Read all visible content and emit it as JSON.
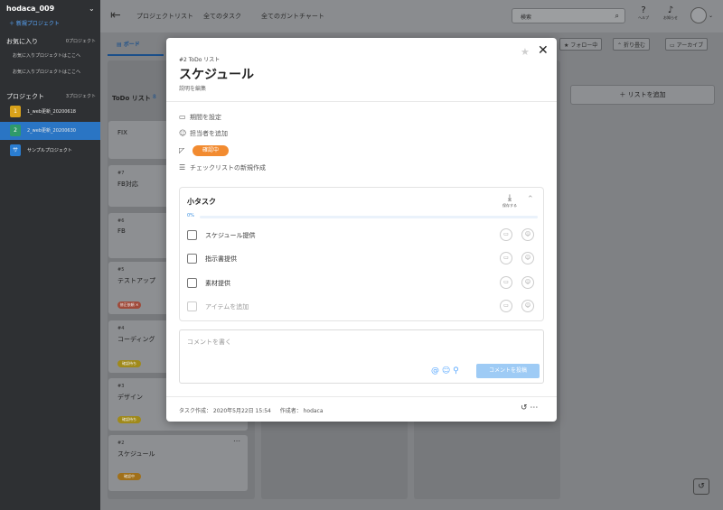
{
  "sidebar": {
    "workspace": "hodaca_009",
    "new_project": "新規プロジェクト",
    "favorites_title": "お気に入り",
    "favorites_count": "0プロジェクト",
    "favorite_placeholders": [
      "お気に入りプロジェクトはここへ",
      "お気に入りプロジェクトはここへ"
    ],
    "projects_title": "プロジェクト",
    "projects_count": "3プロジェクト",
    "projects": [
      {
        "icon": "1",
        "name": "1_web更新_20200618",
        "color": "#d9a21a",
        "active": false
      },
      {
        "icon": "2",
        "name": "2_web更新_20200630",
        "color": "#2f9a6a",
        "active": true
      },
      {
        "icon": "サ",
        "name": "サンプルプロジェクト",
        "color": "#2a7dd1",
        "active": false
      }
    ]
  },
  "topbar": {
    "links": [
      "プロジェクトリスト",
      "全てのタスク",
      "全てのガントチャート"
    ],
    "search_placeholder": "検索",
    "help_label": "ヘルプ",
    "notify_label": "お知らせ"
  },
  "board": {
    "tab": "ボード",
    "actions": [
      "フォロー中",
      "折り畳む",
      "アーカイブ"
    ],
    "column_title": "ToDo リスト",
    "column_count": "8",
    "add_list": "リストを追加",
    "cards": [
      {
        "num": "",
        "title": "FIX",
        "badge": ""
      },
      {
        "num": "#7",
        "title": "FB対応",
        "badge": ""
      },
      {
        "num": "#6",
        "title": "FB",
        "badge": ""
      },
      {
        "num": "#5",
        "title": "テストアップ",
        "badge": "修正依頼 ✕"
      },
      {
        "num": "#4",
        "title": "コーディング",
        "badge": "確認待ち"
      },
      {
        "num": "#3",
        "title": "デザイン",
        "badge": "確認待ち"
      },
      {
        "num": "#2",
        "title": "スケジュール",
        "badge": "確認中"
      }
    ]
  },
  "modal": {
    "crumb": "#2 ToDo リスト",
    "title": "スケジュール",
    "desc": "説明を編集",
    "rows": {
      "period": "期間を設定",
      "assignee": "担当者を追加",
      "status": "確認中",
      "checklist": "チェックリストの新規作成"
    },
    "subtask": {
      "title": "小タスク",
      "save_label": "保存する",
      "percent": "0%",
      "items": [
        "スケジュール提供",
        "指示書提供",
        "素材提供"
      ],
      "add_placeholder": "アイテムを追加"
    },
    "comment": {
      "placeholder": "コメントを書く",
      "submit": "コメントを投稿"
    },
    "footer": {
      "created": "タスク作成： 2020年5月22日 15:54",
      "author": "作成者： hodaca"
    }
  }
}
